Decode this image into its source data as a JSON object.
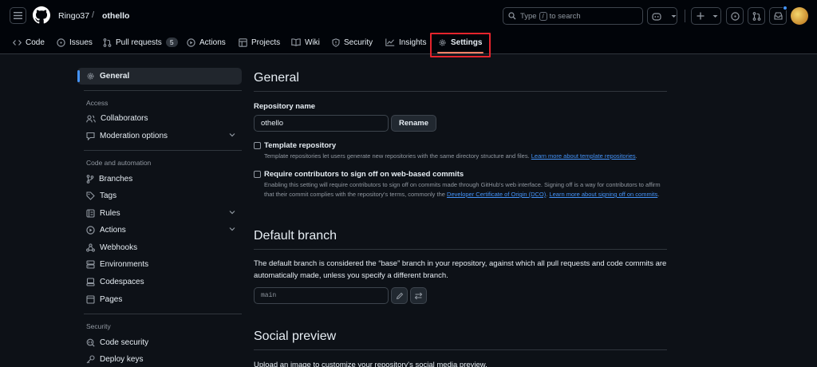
{
  "header": {
    "owner": "Ringo37",
    "separator": "/",
    "repo": "othello",
    "search_prefix": "Type",
    "search_key": "/",
    "search_suffix": "to search"
  },
  "tabs": [
    {
      "label": "Code",
      "icon": "code-icon"
    },
    {
      "label": "Issues",
      "icon": "issue-icon"
    },
    {
      "label": "Pull requests",
      "icon": "pull-request-icon",
      "count": "5"
    },
    {
      "label": "Actions",
      "icon": "play-icon"
    },
    {
      "label": "Projects",
      "icon": "table-icon"
    },
    {
      "label": "Wiki",
      "icon": "book-icon"
    },
    {
      "label": "Security",
      "icon": "shield-icon"
    },
    {
      "label": "Insights",
      "icon": "graph-icon"
    },
    {
      "label": "Settings",
      "icon": "gear-icon",
      "active": true
    }
  ],
  "sidebar": {
    "general": "General",
    "access_heading": "Access",
    "access": [
      "Collaborators",
      "Moderation options"
    ],
    "code_heading": "Code and automation",
    "code": [
      "Branches",
      "Tags",
      "Rules",
      "Actions",
      "Webhooks",
      "Environments",
      "Codespaces",
      "Pages"
    ],
    "security_heading": "Security",
    "security": [
      "Code security",
      "Deploy keys"
    ]
  },
  "general": {
    "title": "General",
    "repo_name_label": "Repository name",
    "repo_name_value": "othello",
    "rename_button": "Rename",
    "template_title": "Template repository",
    "template_note": "Template repositories let users generate new repositories with the same directory structure and files.",
    "template_link": "Learn more about template repositories",
    "signoff_title": "Require contributors to sign off on web-based commits",
    "signoff_note_1": "Enabling this setting will require contributors to sign off on commits made through GitHub's web interface. Signing off is a way for contributors to affirm that their commit complies with the repository's terms, commonly the",
    "signoff_link_1": "Developer Certificate of Origin (DCO)",
    "signoff_link_2": "Learn more about signing off on commits"
  },
  "default_branch": {
    "title": "Default branch",
    "description": "The default branch is considered the “base” branch in your repository, against which all pull requests and code commits are automatically made, unless you specify a different branch.",
    "branch": "main"
  },
  "social_preview": {
    "title": "Social preview",
    "description": "Upload an image to customize your repository's social media preview."
  },
  "colors": {
    "background": "#0d1117",
    "header": "#010409",
    "accent_link": "#4493f8",
    "tab_underline": "#f78166",
    "highlight": "#e5242c"
  }
}
